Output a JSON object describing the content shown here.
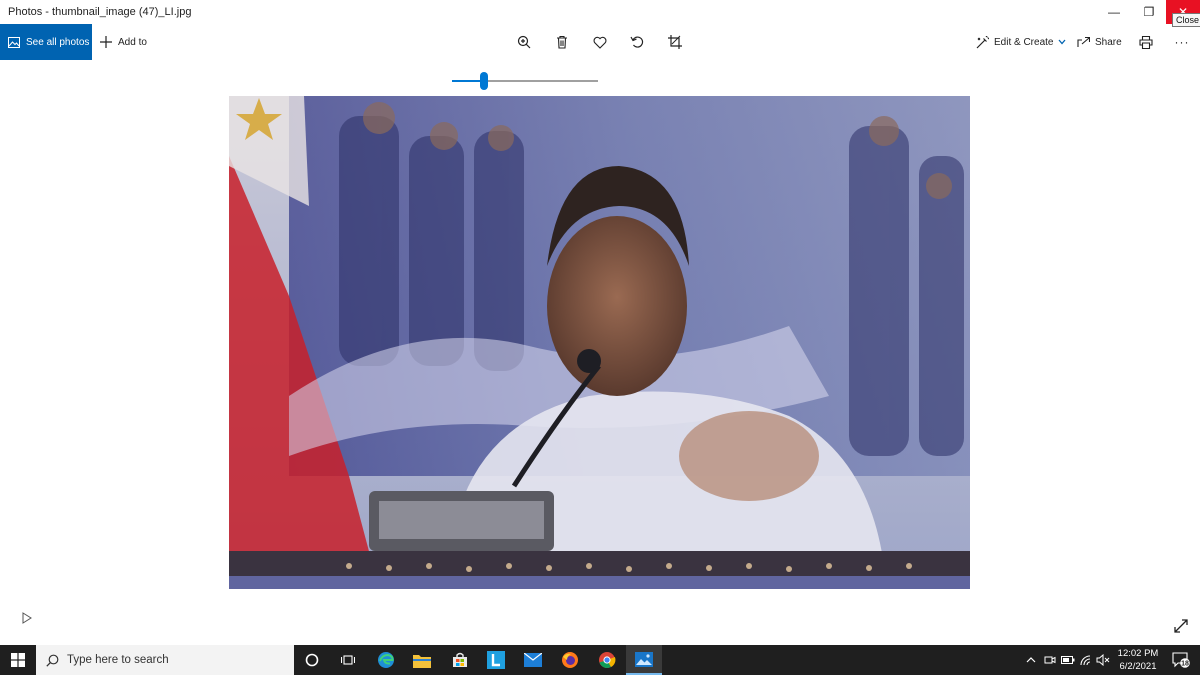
{
  "window": {
    "title": "Photos - thumbnail_image (47)_LI.jpg",
    "minimize_glyph": "—",
    "maximize_glyph": "❐",
    "close_glyph": "✕",
    "close_tooltip": "Close"
  },
  "toolbar": {
    "see_all_photos": "See all photos",
    "add_to": "Add to",
    "zoom_icon": "zoom-in-icon",
    "delete_icon": "trash-icon",
    "favorite_icon": "heart-icon",
    "rotate_icon": "rotate-icon",
    "crop_icon": "crop-icon",
    "edit_create": "Edit & Create",
    "share": "Share",
    "print_icon": "printer-icon",
    "more": "···"
  },
  "zoom_slider": {
    "value_fraction": 0.22
  },
  "taskbar": {
    "search_placeholder": "Type here to search",
    "time": "12:02 PM",
    "date": "6/2/2021",
    "notification_count": "18"
  },
  "colors": {
    "accent": "#0063b1",
    "close_red": "#e81123",
    "taskbar": "#1f1f1f"
  }
}
